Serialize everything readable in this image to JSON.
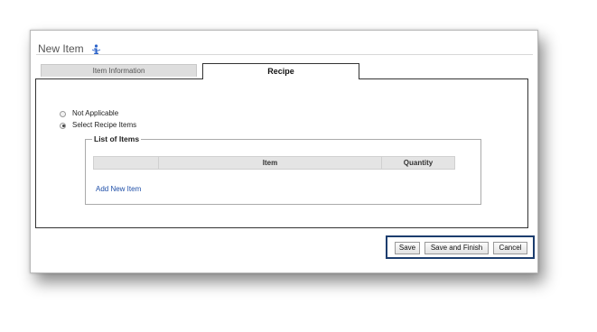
{
  "dialog": {
    "title": "New Item",
    "info_icon": "info-icon"
  },
  "tabs": [
    {
      "label": "Item Information",
      "active": false
    },
    {
      "label": "Recipe",
      "active": true
    }
  ],
  "recipe": {
    "options": [
      {
        "label": "Not Applicable",
        "selected": false
      },
      {
        "label": "Select Recipe Items",
        "selected": true
      }
    ],
    "list_legend": "List of Items",
    "columns": [
      "",
      "Item",
      "Quantity"
    ],
    "add_link": "Add New Item"
  },
  "actions": {
    "save": "Save",
    "save_finish": "Save and Finish",
    "cancel": "Cancel"
  },
  "colors": {
    "highlight_border": "#1c3d6e",
    "link": "#1f4fa8"
  }
}
